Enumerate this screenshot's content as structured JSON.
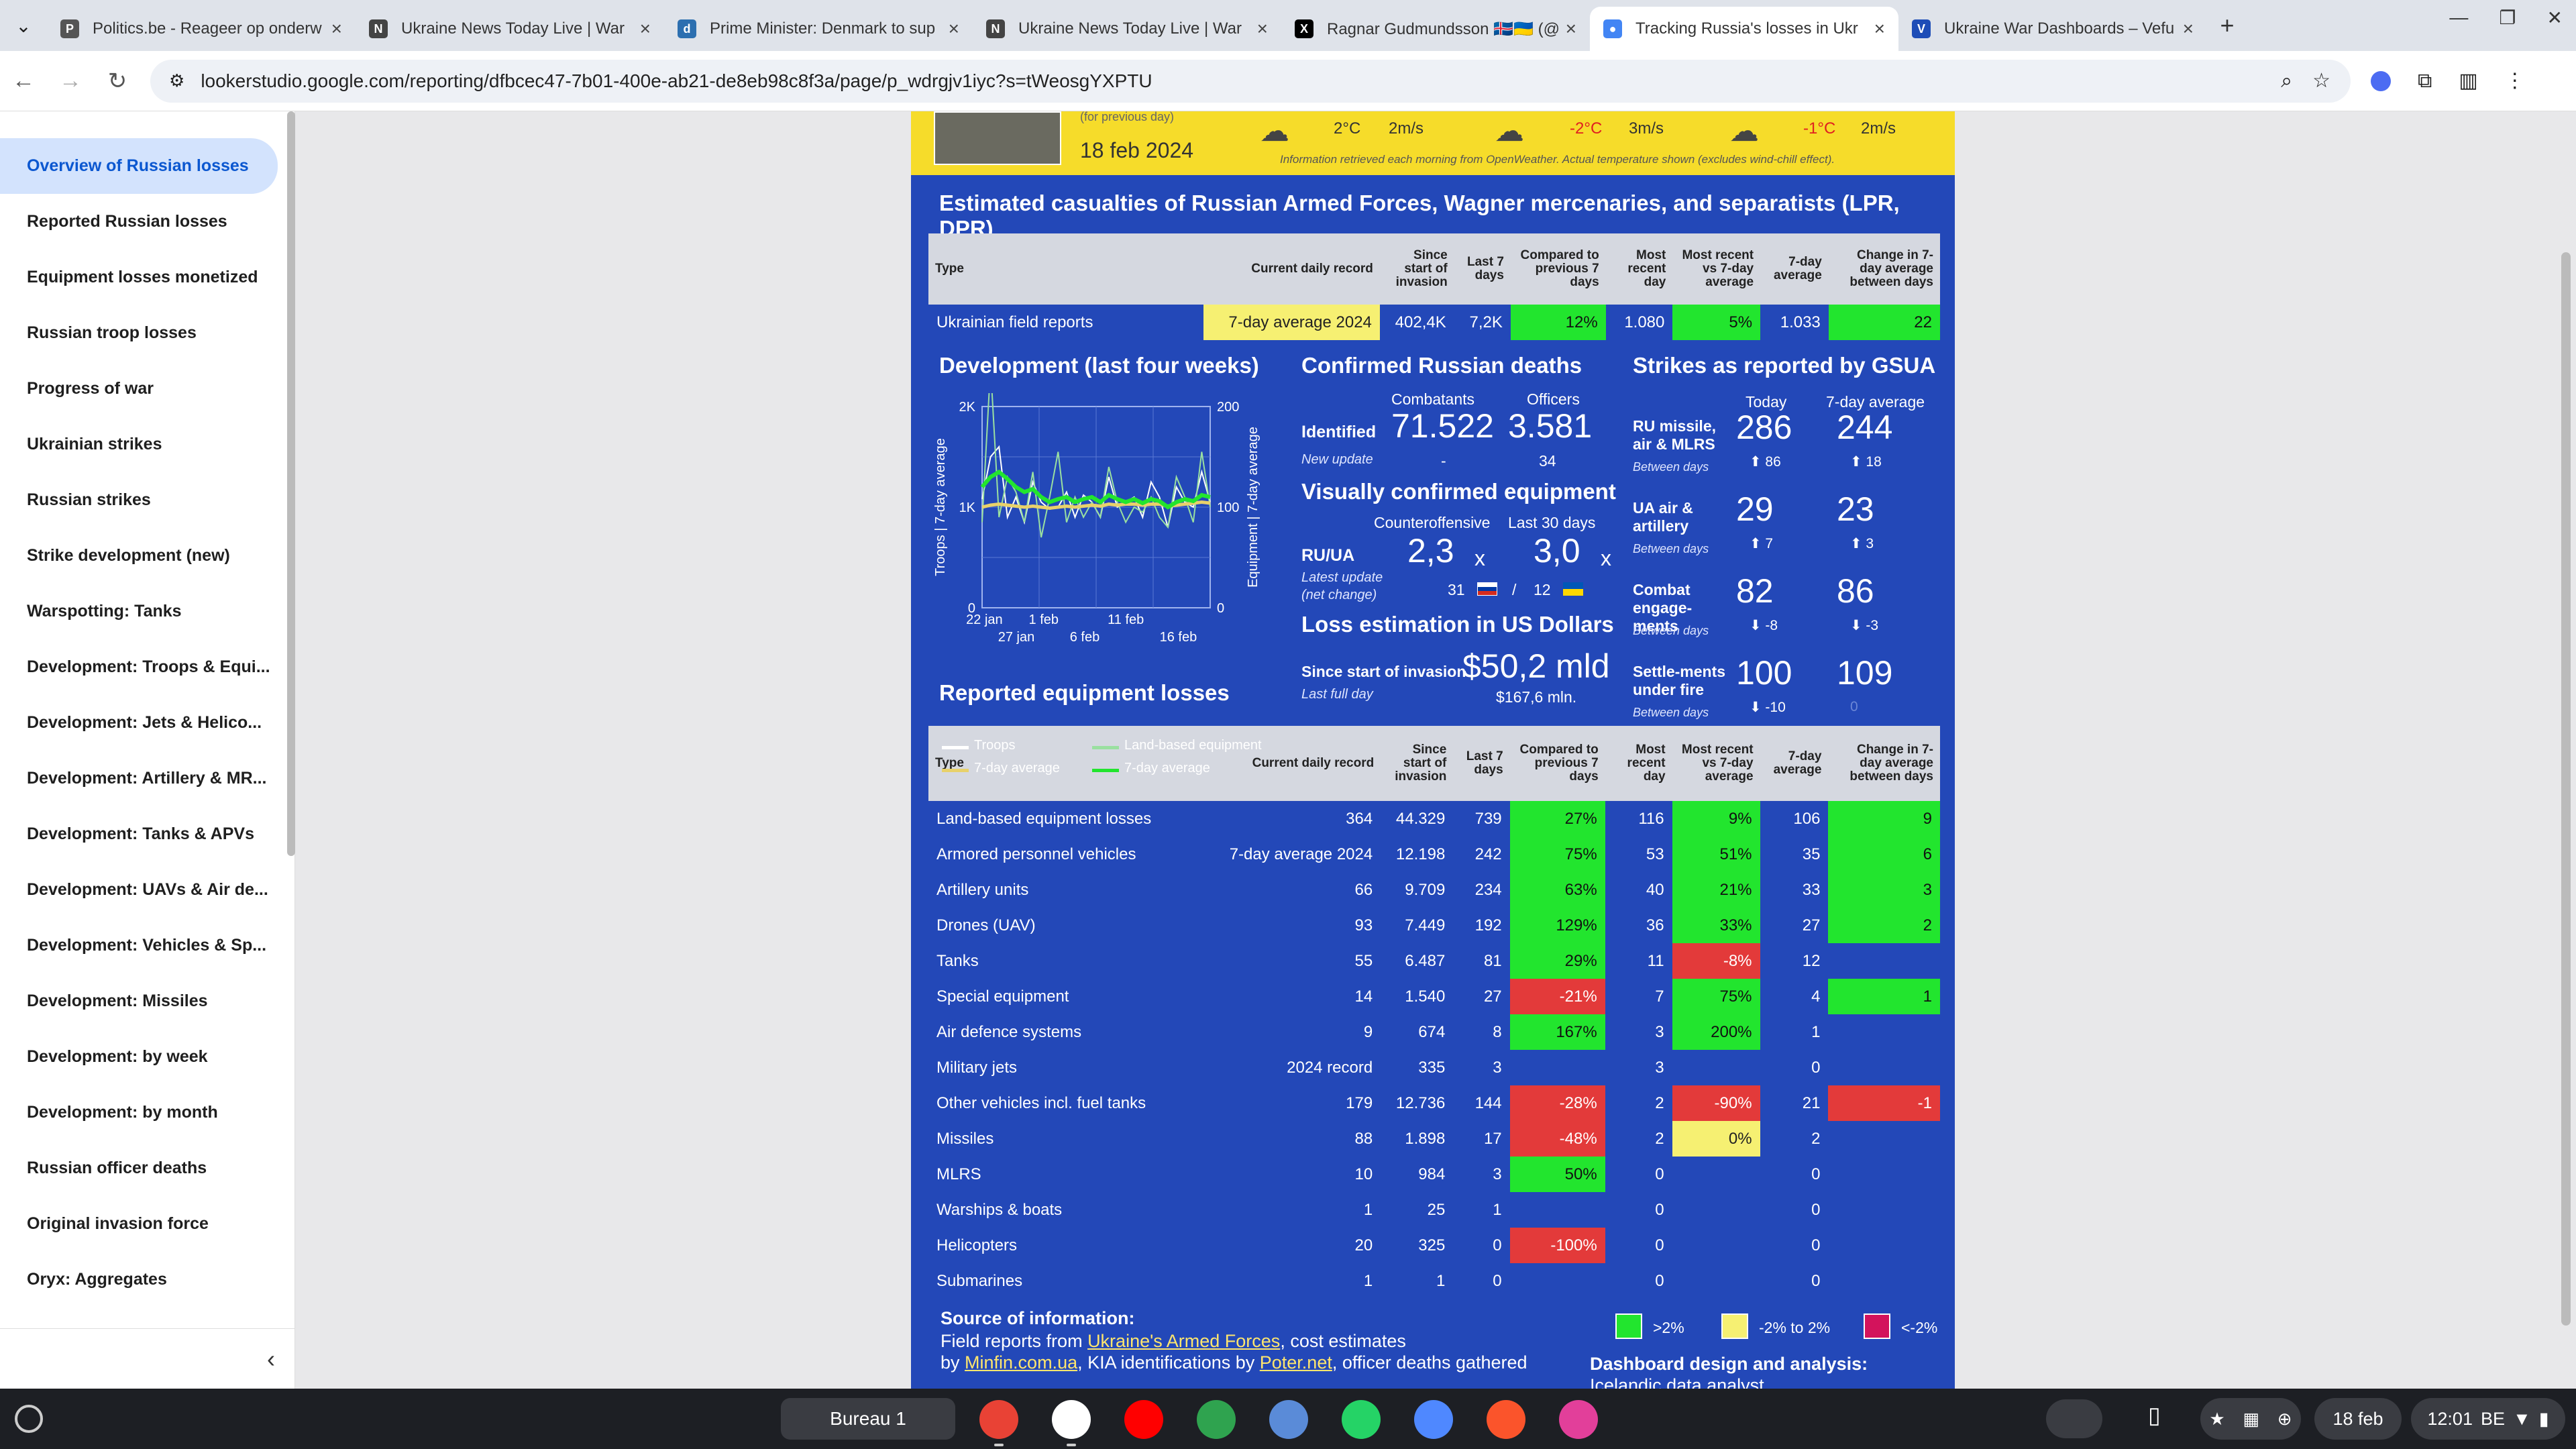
{
  "browser": {
    "tabs": [
      {
        "title": "Politics.be - Reageer op onderw",
        "fav": "P",
        "color": "#555555"
      },
      {
        "title": "Ukraine News Today Live | War",
        "fav": "N",
        "color": "#444444"
      },
      {
        "title": "Prime Minister: Denmark to sup",
        "fav": "d",
        "color": "#2c6fb0"
      },
      {
        "title": "Ukraine News Today Live | War",
        "fav": "N",
        "color": "#444444"
      },
      {
        "title": "Ragnar Gudmundsson 🇮🇸🇺🇦 (@",
        "fav": "X",
        "color": "#000000"
      },
      {
        "title": "Tracking Russia's losses in Ukr",
        "fav": "●",
        "color": "#4285f4"
      },
      {
        "title": "Ukraine War Dashboards – Vefu",
        "fav": "V",
        "color": "#1e4db7"
      }
    ],
    "url": "lookerstudio.google.com/reporting/dfbcec47-7b01-400e-ab21-de8eb98c8f3a/page/p_wdrgjv1iyc?s=tWeosgYXPTU"
  },
  "sidebar": {
    "items": [
      "Overview of Russian losses",
      "Reported Russian losses",
      "Equipment losses monetized",
      "Russian troop losses",
      "Progress of war",
      "Ukrainian strikes",
      "Russian strikes",
      "Strike development (new)",
      "Warspotting: Tanks",
      "Development: Troops & Equi...",
      "Development: Jets & Helico...",
      "Development: Artillery & MR...",
      "Development: Tanks & APVs",
      "Development: UAVs & Air de...",
      "Development: Vehicles & Sp...",
      "Development: Missiles",
      "Development: by week",
      "Development: by month",
      "Russian officer deaths",
      "Original invasion force",
      "Oryx: Aggregates"
    ]
  },
  "weather": {
    "prev_note": "(for previous day)",
    "date": "18 feb 2024",
    "items": [
      {
        "temp": "2°C",
        "wind": "2m/s"
      },
      {
        "temp": "-2°C",
        "wind": "3m/s"
      },
      {
        "temp": "-1°C",
        "wind": "2m/s"
      }
    ],
    "note": "Information retrieved each morning from OpenWeather. Actual temperature shown (excludes wind-chill effect)."
  },
  "report": {
    "title": "Estimated casualties of Russian Armed Forces, Wagner mercenaries, and separatists (LPR, DPR)"
  },
  "casualties": {
    "headers": [
      "Type",
      "Current daily record",
      "Since start of invasion",
      "Last 7 days",
      "Compared to previous 7 days",
      "Most recent day",
      "Most recent vs 7-day average",
      "7-day average",
      "Change in 7-day average between days"
    ],
    "row": [
      "Ukrainian field reports",
      "7-day average 2024",
      "402,4K",
      "7,2K",
      "12%",
      "1.080",
      "5%",
      "1.033",
      "22"
    ]
  },
  "development": {
    "title": "Development (last four weeks)",
    "yleft": "Troops | 7-day average",
    "yright": "Equipment | 7-day average",
    "yticks_left": [
      "2K",
      "1K",
      "0"
    ],
    "yticks_right": [
      "200",
      "100",
      "0"
    ],
    "xticks_top": [
      "22 jan",
      "1 feb",
      "11 feb"
    ],
    "xticks_bottom": [
      "27 jan",
      "6 feb",
      "16 feb"
    ],
    "legend": [
      "Troops",
      "Land-based equipment",
      "7-day average",
      "7-day average"
    ]
  },
  "chart_data": {
    "type": "line",
    "title": "Development (last four weeks)",
    "ylabel": "Troops | 7-day average",
    "y2label": "Equipment | 7-day average",
    "ylim": [
      0,
      2000
    ],
    "y2lim": [
      0,
      200
    ],
    "series": [
      {
        "name": "Troops",
        "values": [
          1080,
          1500,
          1600,
          900,
          1100,
          850,
          1250,
          1050,
          980,
          1000,
          1150,
          900,
          1120,
          1050,
          900,
          1300,
          1000,
          1050,
          1100,
          900,
          1250,
          1100,
          800,
          1200,
          1050,
          1000,
          1350,
          1050
        ]
      },
      {
        "name": "Land-based equipment",
        "values": [
          85,
          240,
          90,
          130,
          115,
          85,
          135,
          70,
          110,
          155,
          85,
          110,
          90,
          105,
          90,
          140,
          105,
          85,
          100,
          95,
          110,
          90,
          80,
          130,
          110,
          85,
          155,
          100
        ]
      },
      {
        "name": "7-day average",
        "values": [
          1000,
          1020,
          1030,
          1020,
          1010,
          1000,
          1010,
          1000,
          990,
          1000,
          1010,
          1000,
          1010,
          1020,
          1010,
          1030,
          1020,
          1030,
          1030,
          1020,
          1030,
          1030,
          1010,
          1020,
          1030,
          1040,
          1050,
          1040
        ]
      },
      {
        "name": "7-day average",
        "values": [
          120,
          130,
          135,
          128,
          120,
          115,
          118,
          110,
          105,
          108,
          110,
          105,
          108,
          110,
          105,
          112,
          108,
          105,
          108,
          104,
          108,
          106,
          100,
          105,
          108,
          106,
          112,
          110
        ]
      }
    ]
  },
  "deaths": {
    "title": "Confirmed Russian deaths",
    "col1": "Combatants",
    "col2": "Officers",
    "label": "Identified",
    "new": "New update",
    "v1": "71.522",
    "v2": "3.581",
    "d1": "-",
    "d2": "34"
  },
  "equipment_visual": {
    "title": "Visually confirmed equipment",
    "col1": "Counteroffensive",
    "col2": "Last 30 days",
    "label": "RU/UA",
    "sub1": "Latest update",
    "sub2": "(net change)",
    "v1": "2,3",
    "v2": "3,0",
    "x": "x",
    "n1": "31",
    "n2": "12",
    "slash": "/"
  },
  "loss": {
    "title": "Loss estimation in US Dollars",
    "label": "Since start of invasion",
    "sub": "Last full day",
    "value": "$50,2 mld",
    "day": "$167,6 mln."
  },
  "strikes": {
    "title": "Strikes as reported by GSUA",
    "col1": "Today",
    "col2": "7-day average",
    "sub": "Between days",
    "rows": [
      {
        "name": "RU missile, air & MLRS",
        "today": "286",
        "avg": "244",
        "d1": "⬆ 86",
        "d2": "⬆ 18"
      },
      {
        "name": "UA air & artillery",
        "today": "29",
        "avg": "23",
        "d1": "⬆ 7",
        "d2": "⬆ 3"
      },
      {
        "name": "Combat engage-ments",
        "today": "82",
        "avg": "86",
        "d1": "⬇ -8",
        "d2": "⬇ -3"
      },
      {
        "name": "Settle-ments under fire",
        "today": "100",
        "avg": "109",
        "d1": "⬇ -10",
        "d2": "0"
      }
    ]
  },
  "equipment": {
    "title": "Reported equipment losses",
    "headers": [
      "Type",
      "Current daily record",
      "Since start of invasion",
      "Last 7 days",
      "Compared to previous 7 days",
      "Most recent day",
      "Most recent vs 7-day average",
      "7-day average",
      "Change in 7-day average between days"
    ],
    "rows": [
      [
        "Land-based equipment losses",
        "364",
        "44.329",
        "739",
        "27%",
        "116",
        "9%",
        "106",
        "9"
      ],
      [
        "Armored personnel vehicles",
        "7-day average 2024",
        "12.198",
        "242",
        "75%",
        "53",
        "51%",
        "35",
        "6"
      ],
      [
        "Artillery units",
        "66",
        "9.709",
        "234",
        "63%",
        "40",
        "21%",
        "33",
        "3"
      ],
      [
        "Drones (UAV)",
        "93",
        "7.449",
        "192",
        "129%",
        "36",
        "33%",
        "27",
        "2"
      ],
      [
        "Tanks",
        "55",
        "6.487",
        "81",
        "29%",
        "11",
        "-8%",
        "12",
        ""
      ],
      [
        "Special equipment",
        "14",
        "1.540",
        "27",
        "-21%",
        "7",
        "75%",
        "4",
        "1"
      ],
      [
        "Air defence systems",
        "9",
        "674",
        "8",
        "167%",
        "3",
        "200%",
        "1",
        ""
      ],
      [
        "Military jets",
        "2024 record",
        "335",
        "3",
        "",
        "3",
        "",
        "0",
        ""
      ],
      [
        "Other vehicles incl. fuel tanks",
        "179",
        "12.736",
        "144",
        "-28%",
        "2",
        "-90%",
        "21",
        "-1"
      ],
      [
        "Missiles",
        "88",
        "1.898",
        "17",
        "-48%",
        "2",
        "0%",
        "2",
        ""
      ],
      [
        "MLRS",
        "10",
        "984",
        "3",
        "50%",
        "0",
        "",
        "0",
        ""
      ],
      [
        "Warships & boats",
        "1",
        "25",
        "1",
        "",
        "0",
        "",
        "0",
        ""
      ],
      [
        "Helicopters",
        "20",
        "325",
        "0",
        "-100%",
        "0",
        "",
        "0",
        ""
      ],
      [
        "Submarines",
        "1",
        "1",
        "0",
        "",
        "0",
        "",
        "0",
        ""
      ]
    ]
  },
  "footer": {
    "title": "Source of information:",
    "l1a": "Field reports from ",
    "l1b": "Ukraine's Armed Forces",
    "l1c": ", cost estimates",
    "l2a": "by ",
    "l2b": "Minfin.com.ua",
    "l2c": ", KIA identifications by ",
    "l2d": "Poter.net",
    "l2e": ", officer deaths gathered",
    "legend": [
      ">2%",
      "-2% to 2%",
      "<-2%"
    ],
    "design": "Dashboard design and analysis:",
    "design_sub": "Icelandic data analyst"
  },
  "taskbar": {
    "desk": "Bureau 1",
    "date": "18 feb",
    "time": "12:01",
    "locale": "BE"
  }
}
